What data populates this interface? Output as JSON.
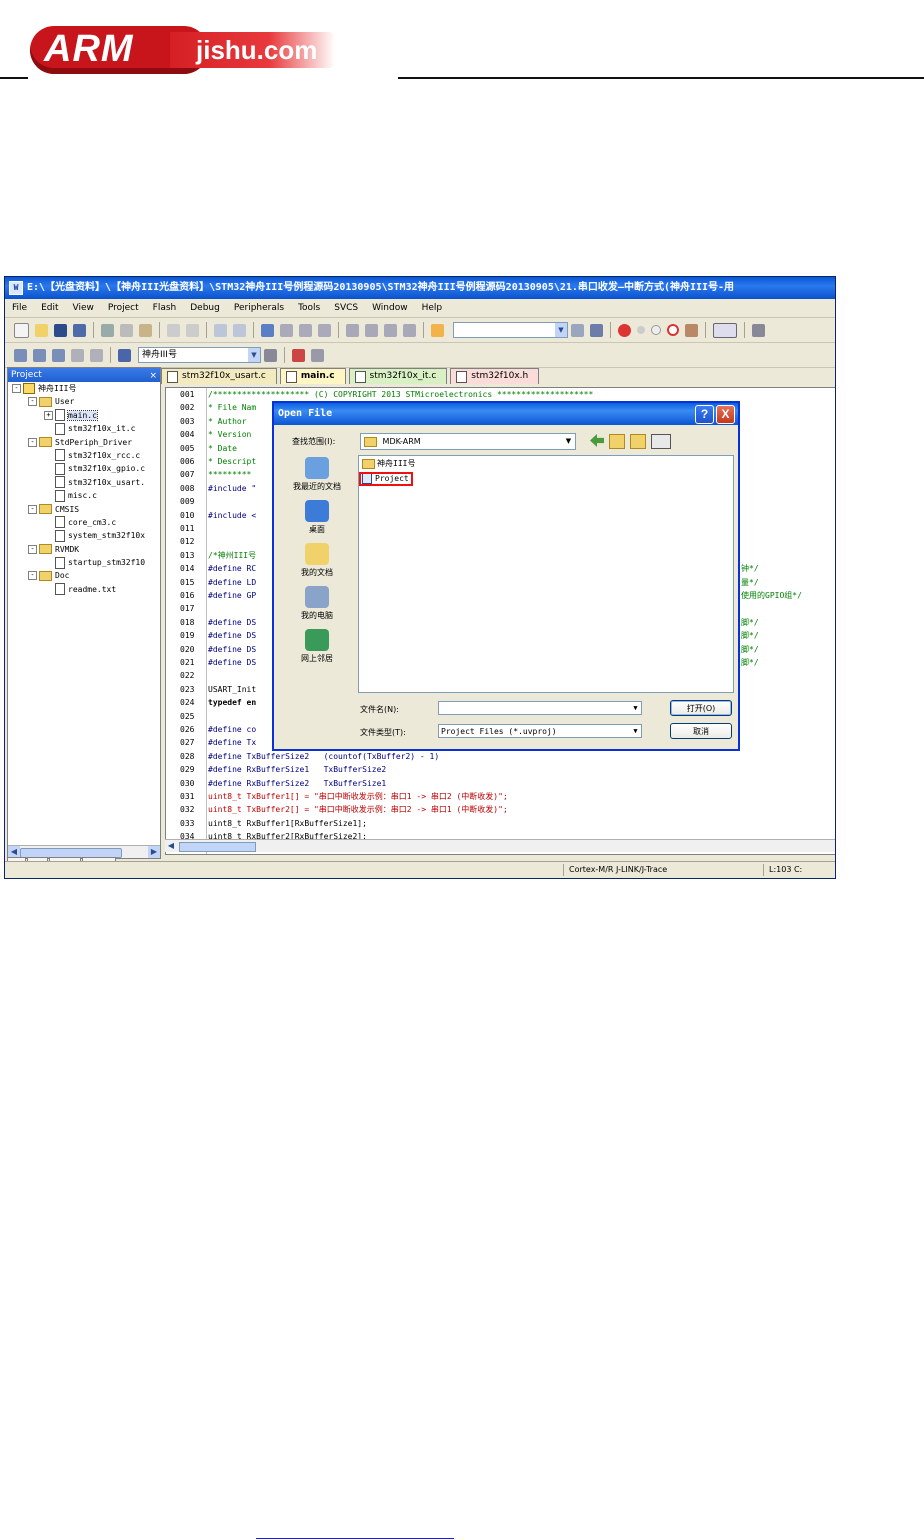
{
  "logo": {
    "arm": "ARM",
    "domain": "jishu.com"
  },
  "window": {
    "title": "E:\\【光盘资料】\\【神舟III光盘资料】\\STM32神舟III号例程源码20130905\\STM32神舟III号例程源码20130905\\21.串口收发—中断方式(神舟III号-用",
    "menu": [
      "File",
      "Edit",
      "View",
      "Project",
      "Flash",
      "Debug",
      "Peripherals",
      "Tools",
      "SVCS",
      "Window",
      "Help"
    ],
    "target_combo": "神舟III号"
  },
  "project": {
    "header": "Project",
    "close": "×",
    "tree": [
      {
        "level": 0,
        "kind": "root",
        "label": "神舟III号",
        "box": "-"
      },
      {
        "level": 1,
        "kind": "folder",
        "label": "User",
        "box": "-"
      },
      {
        "level": 2,
        "kind": "file",
        "label": "main.c",
        "box": "+",
        "selected": true
      },
      {
        "level": 2,
        "kind": "file",
        "label": "stm32f10x_it.c",
        "box": ""
      },
      {
        "level": 1,
        "kind": "folder",
        "label": "StdPeriph_Driver",
        "box": "-"
      },
      {
        "level": 2,
        "kind": "file",
        "label": "stm32f10x_rcc.c",
        "box": ""
      },
      {
        "level": 2,
        "kind": "file",
        "label": "stm32f10x_gpio.c",
        "box": ""
      },
      {
        "level": 2,
        "kind": "file",
        "label": "stm32f10x_usart.",
        "box": ""
      },
      {
        "level": 2,
        "kind": "file",
        "label": "misc.c",
        "box": ""
      },
      {
        "level": 1,
        "kind": "folder",
        "label": "CMSIS",
        "box": "-"
      },
      {
        "level": 2,
        "kind": "file",
        "label": "core_cm3.c",
        "box": ""
      },
      {
        "level": 2,
        "kind": "file",
        "label": "system_stm32f10x",
        "box": ""
      },
      {
        "level": 1,
        "kind": "folder",
        "label": "RVMDK",
        "box": "-"
      },
      {
        "level": 2,
        "kind": "file",
        "label": "startup_stm32f10",
        "box": ""
      },
      {
        "level": 1,
        "kind": "folder",
        "label": "Doc",
        "box": "-"
      },
      {
        "level": 2,
        "kind": "file",
        "label": "readme.txt",
        "box": ""
      }
    ],
    "bottom_tabs": [
      "P...",
      "B...",
      "{} F...",
      "0→ T..."
    ]
  },
  "editor": {
    "tabs": [
      "stm32f10x_usart.c",
      "main.c",
      "stm32f10x_it.c",
      "stm32f10x.h"
    ],
    "lines": [
      {
        "n": "001",
        "t": "/******************** (C) COPYRIGHT 2013 STMicroelectronics ********************",
        "c": "green"
      },
      {
        "n": "002",
        "t": "* File Nam",
        "c": "green"
      },
      {
        "n": "003",
        "t": "* Author",
        "c": "green"
      },
      {
        "n": "004",
        "t": "* Version",
        "c": "green"
      },
      {
        "n": "005",
        "t": "* Date",
        "c": "green"
      },
      {
        "n": "006",
        "t": "* Descript",
        "c": "green"
      },
      {
        "n": "007",
        "t": "*********",
        "c": "green"
      },
      {
        "n": "008",
        "t": "#include \"",
        "c": "blue"
      },
      {
        "n": "009",
        "t": "",
        "c": ""
      },
      {
        "n": "010",
        "t": "#include <",
        "c": "blue"
      },
      {
        "n": "011",
        "t": "",
        "c": ""
      },
      {
        "n": "012",
        "t": "",
        "c": ""
      },
      {
        "n": "013",
        "t": "/*神州III号",
        "c": "green"
      },
      {
        "n": "014",
        "t": "#define RC",
        "c": "blue",
        "r": "钟*/"
      },
      {
        "n": "015",
        "t": "#define LD",
        "c": "blue",
        "r": "量*/"
      },
      {
        "n": "016",
        "t": "#define GP",
        "c": "blue",
        "r": "使用的GPIO组*/"
      },
      {
        "n": "017",
        "t": "",
        "c": ""
      },
      {
        "n": "018",
        "t": "#define DS",
        "c": "blue",
        "r": "脚*/"
      },
      {
        "n": "019",
        "t": "#define DS",
        "c": "blue",
        "r": "脚*/"
      },
      {
        "n": "020",
        "t": "#define DS",
        "c": "blue",
        "r": "脚*/"
      },
      {
        "n": "021",
        "t": "#define DS",
        "c": "blue",
        "r": "脚*/"
      },
      {
        "n": "022",
        "t": "",
        "c": ""
      },
      {
        "n": "023",
        "t": "USART_Init",
        "c": ""
      },
      {
        "n": "024",
        "t": "typedef en",
        "c": "bold"
      },
      {
        "n": "025",
        "t": "",
        "c": ""
      },
      {
        "n": "026",
        "t": "#define co",
        "c": "blue"
      },
      {
        "n": "027",
        "t": "#define Tx",
        "c": "blue"
      },
      {
        "n": "028",
        "t": "#define TxBufferSize2   (countof(TxBuffer2) - 1)",
        "c": "blue"
      },
      {
        "n": "029",
        "t": "#define RxBufferSize1   TxBufferSize2",
        "c": "blue"
      },
      {
        "n": "030",
        "t": "#define RxBufferSize2   TxBufferSize1",
        "c": "blue"
      },
      {
        "n": "031",
        "t": "uint8_t TxBuffer1[] = \"串口中断收发示例：串口1 -> 串口2 (中断收发)\";",
        "c": "mix"
      },
      {
        "n": "032",
        "t": "uint8_t TxBuffer2[] = \"串口中断收发示例：串口2 -> 串口1 (中断收发)\";",
        "c": "mix"
      },
      {
        "n": "033",
        "t": "uint8_t RxBuffer1[RxBufferSize1];",
        "c": ""
      },
      {
        "n": "034",
        "t": "uint8_t RxBuffer2[RxBufferSize2];",
        "c": ""
      }
    ]
  },
  "status": {
    "target": "Cortex-M/R J-LINK/J-Trace",
    "position": "L:103 C:"
  },
  "dialog": {
    "title": "Open File",
    "help": "?",
    "close": "X",
    "lookin_label": "查找范围(I):",
    "lookin_value": "MDK-ARM",
    "places": [
      "我最近的文档",
      "桌面",
      "我的文档",
      "我的电脑",
      "网上邻居"
    ],
    "items": [
      {
        "kind": "folder",
        "label": "神舟III号"
      },
      {
        "kind": "project",
        "label": "Project",
        "highlighted": true
      }
    ],
    "filename_label": "文件名(N):",
    "filename_value": "",
    "filetype_label": "文件类型(T):",
    "filetype_value": "Project Files (*.uvproj)",
    "open_button": "打开(O)",
    "cancel_button": "取消"
  }
}
